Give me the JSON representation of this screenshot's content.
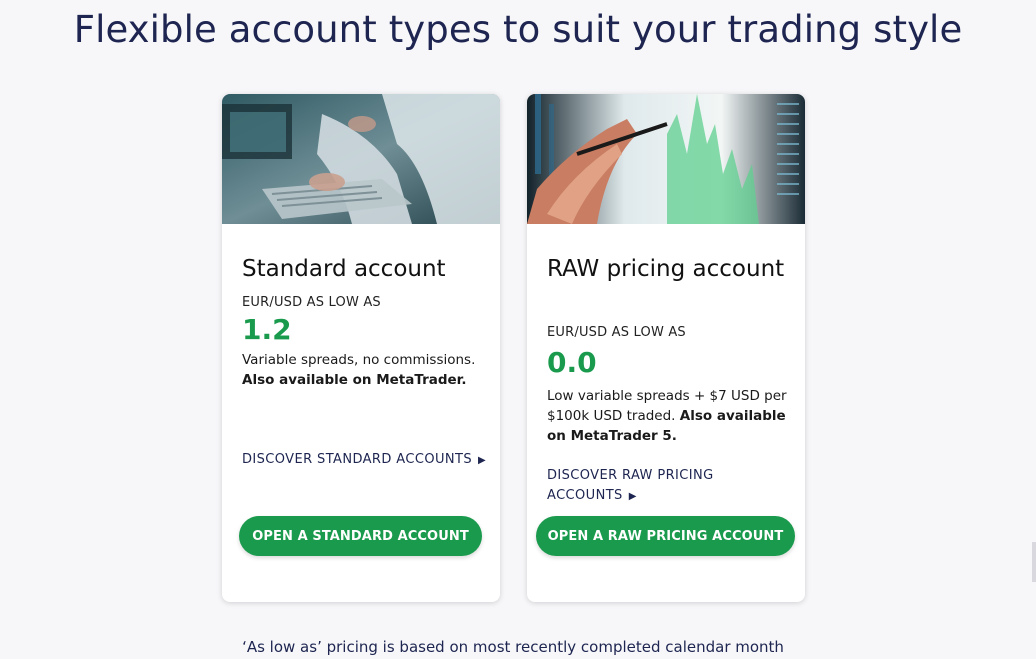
{
  "page": {
    "heading": "Flexible account types to suit your trading style",
    "footnote": "‘As low as’ pricing is based on most recently completed calendar month"
  },
  "cards": [
    {
      "title": "Standard account",
      "kicker": "EUR/USD AS LOW AS",
      "price": "1.2",
      "desc": "Variable spreads, no commissions.",
      "desc_bold": "Also available on MetaTrader.",
      "discover": "DISCOVER STANDARD ACCOUNTS",
      "cta": "OPEN A STANDARD ACCOUNT"
    },
    {
      "title": "RAW pricing account",
      "kicker": "EUR/USD AS LOW AS",
      "price": "0.0",
      "desc": "Low variable spreads + $7 USD per $100k USD traded.",
      "desc_bold": "Also available on MetaTrader 5.",
      "discover": "DISCOVER RAW PRICING ACCOUNTS",
      "cta": "OPEN A RAW PRICING ACCOUNT"
    }
  ],
  "icons": {
    "discover_arrow": "▶"
  },
  "colors": {
    "accent_green": "#1a9a4d",
    "navy": "#1d2550"
  }
}
